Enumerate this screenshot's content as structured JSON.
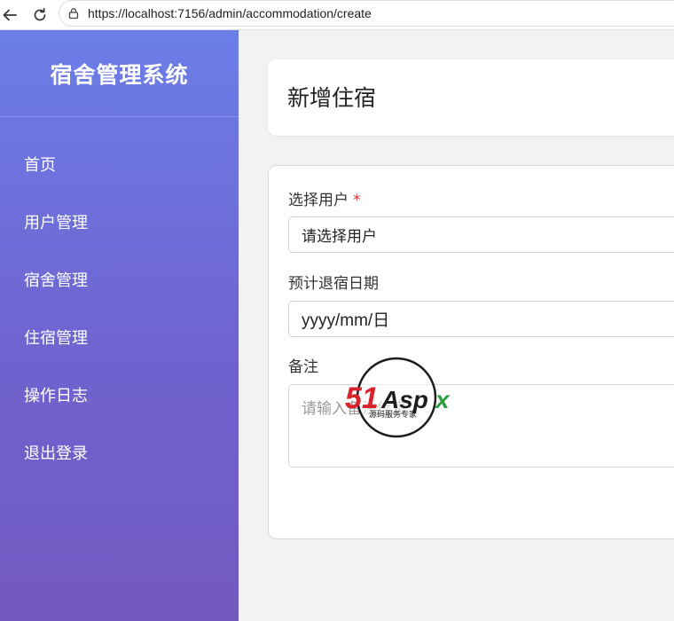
{
  "browser": {
    "url": "https://localhost:7156/admin/accommodation/create"
  },
  "sidebar": {
    "title": "宿舍管理系统",
    "items": [
      {
        "label": "首页"
      },
      {
        "label": "用户管理"
      },
      {
        "label": "宿舍管理"
      },
      {
        "label": "住宿管理"
      },
      {
        "label": "操作日志"
      },
      {
        "label": "退出登录"
      }
    ]
  },
  "page": {
    "title": "新增住宿"
  },
  "form": {
    "user": {
      "label": "选择用户",
      "required_mark": "*",
      "value": "请选择用户"
    },
    "checkout_date": {
      "label": "预计退宿日期",
      "placeholder": "yyyy/mm/日"
    },
    "remark": {
      "label": "备注",
      "placeholder": "请输入备注信息"
    }
  },
  "watermark": {
    "logo_text": "51Aspx",
    "tagline": "源码服务专家"
  },
  "colors": {
    "sidebar_top": "#6b7ee8",
    "sidebar_bottom": "#7259c0",
    "required": "#e03131",
    "watermark_red": "#d8232a",
    "watermark_green": "#2e9e3f"
  }
}
